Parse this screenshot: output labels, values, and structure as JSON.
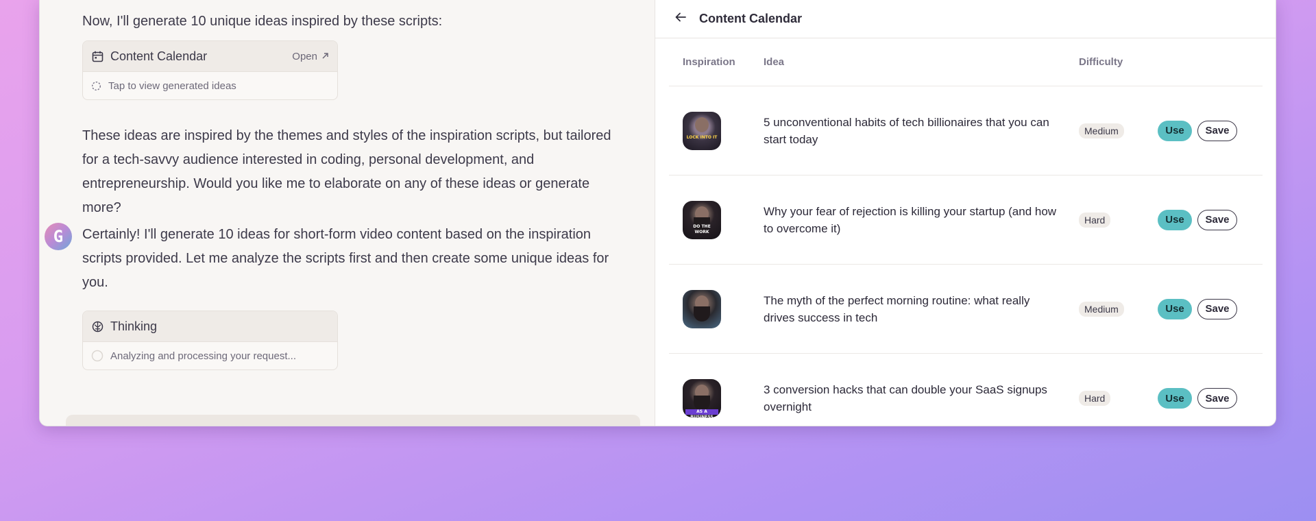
{
  "chat": {
    "intro_line": "Now, I'll generate 10 unique ideas inspired by these scripts:",
    "calendar_card": {
      "title": "Content Calendar",
      "open_label": "Open",
      "body": "Tap to view generated ideas"
    },
    "summary": "These ideas are inspired by the themes and styles of the inspiration scripts, but tailored for a tech-savvy audience interested in coding, personal development, and entrepreneurship. Would you like me to elaborate on any of these ideas or generate more?",
    "avatar_letter": "G",
    "reply": "Certainly! I'll generate 10 ideas for short-form video content based on the inspiration scripts provided. Let me analyze the scripts first and then create some unique ideas for you.",
    "thinking_card": {
      "title": "Thinking",
      "body": "Analyzing and processing your request..."
    }
  },
  "panel": {
    "title": "Content Calendar",
    "columns": {
      "inspiration": "Inspiration",
      "idea": "Idea",
      "difficulty": "Difficulty"
    },
    "rows": [
      {
        "caption": "LOCK INTO IT",
        "idea": "5 unconventional habits of tech billionaires that you can start today",
        "difficulty": "Medium",
        "use": "Use",
        "save": "Save"
      },
      {
        "caption": "DO THE WORK",
        "idea": "Why your fear of rejection is killing your startup (and how to overcome it)",
        "difficulty": "Hard",
        "use": "Use",
        "save": "Save"
      },
      {
        "caption": "",
        "idea": "The myth of the perfect morning routine: what really drives success in tech",
        "difficulty": "Medium",
        "use": "Use",
        "save": "Save"
      },
      {
        "caption": "AS A BUSINESS",
        "idea": "3 conversion hacks that can double your SaaS signups overnight",
        "difficulty": "Hard",
        "use": "Use",
        "save": "Save"
      }
    ]
  },
  "colors": {
    "accent_teal": "#5bbfc3",
    "background_gradient_start": "#e9a3ec",
    "background_gradient_end": "#9c8ff2"
  }
}
